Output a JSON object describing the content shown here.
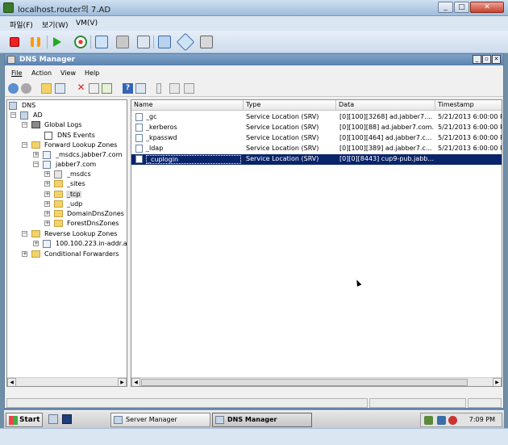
{
  "vm": {
    "title": "localhost.router의 7.AD",
    "menu": [
      "파일(F)",
      "보기(W)",
      "VM(V)"
    ],
    "toolbar_icons": [
      "stop-icon",
      "pause-icon",
      "play-icon",
      "reset-icon",
      "snapshot-icon",
      "revert-icon",
      "manage-snapshots-icon",
      "fit-window-icon",
      "settings-icon",
      "power-icon"
    ],
    "window_buttons": [
      "_",
      "□",
      "✕"
    ]
  },
  "mmc": {
    "title": "DNS Manager",
    "window_buttons": [
      "_",
      "▫",
      "✕"
    ],
    "menu": [
      "File",
      "Action",
      "View",
      "Help"
    ],
    "toolbar_icons": [
      "back-icon",
      "forward-icon",
      "up-folder-icon",
      "show-hide-tree-icon",
      "delete-icon",
      "properties-icon",
      "export-icon",
      "help-icon",
      "show-console-icon",
      "list-icon-1",
      "list-icon-2",
      "list-icon-3"
    ]
  },
  "tree": {
    "nodes": [
      {
        "label": "DNS",
        "icon": "dns-icon",
        "expander": ""
      },
      {
        "label": "AD",
        "icon": "server-icon",
        "expander": "−"
      },
      {
        "label": "Global Logs",
        "icon": "log-folder-icon",
        "expander": "−"
      },
      {
        "label": "DNS Events",
        "icon": "event-log-icon",
        "expander": ""
      },
      {
        "label": "Forward Lookup Zones",
        "icon": "folder-icon",
        "expander": "−"
      },
      {
        "label": "_msdcs.jabber7.com",
        "icon": "zone-icon",
        "expander": "+"
      },
      {
        "label": "jabber7.com",
        "icon": "zone-icon",
        "expander": "−"
      },
      {
        "label": "_msdcs",
        "icon": "zone-delegation-icon",
        "expander": "+"
      },
      {
        "label": "_sites",
        "icon": "folder-icon",
        "expander": "+"
      },
      {
        "label": "_tcp",
        "icon": "folder-icon",
        "expander": "+"
      },
      {
        "label": "_udp",
        "icon": "folder-icon",
        "expander": "+"
      },
      {
        "label": "DomainDnsZones",
        "icon": "folder-icon",
        "expander": "+"
      },
      {
        "label": "ForestDnsZones",
        "icon": "folder-icon",
        "expander": "+"
      },
      {
        "label": "Reverse Lookup Zones",
        "icon": "folder-icon",
        "expander": "−"
      },
      {
        "label": "100.100.223.in-addr.ar",
        "icon": "zone-icon",
        "expander": "+"
      },
      {
        "label": "Conditional Forwarders",
        "icon": "folder-icon",
        "expander": "+"
      }
    ]
  },
  "list": {
    "columns": [
      "Name",
      "Type",
      "Data",
      "Timestamp"
    ],
    "rows": [
      {
        "name": "_gc",
        "type": "Service Location (SRV)",
        "data": "[0][100][3268] ad.jabber7....",
        "timestamp": "5/21/2013 6:00:00 PM"
      },
      {
        "name": "_kerberos",
        "type": "Service Location (SRV)",
        "data": "[0][100][88] ad.jabber7.com.",
        "timestamp": "5/21/2013 6:00:00 PM"
      },
      {
        "name": "_kpasswd",
        "type": "Service Location (SRV)",
        "data": "[0][100][464] ad.jabber7.c...",
        "timestamp": "5/21/2013 6:00:00 PM"
      },
      {
        "name": "_ldap",
        "type": "Service Location (SRV)",
        "data": "[0][100][389] ad.jabber7.c...",
        "timestamp": "5/21/2013 6:00:00 PM"
      },
      {
        "name": "_cuplogin",
        "type": "Service Location (SRV)",
        "data": "[0][0][8443] cup9-pub.jabb...",
        "timestamp": ""
      }
    ]
  },
  "taskbar": {
    "start_label": "Start",
    "tasks": [
      "Server Manager",
      "DNS Manager"
    ],
    "clock": "7:09 PM"
  }
}
